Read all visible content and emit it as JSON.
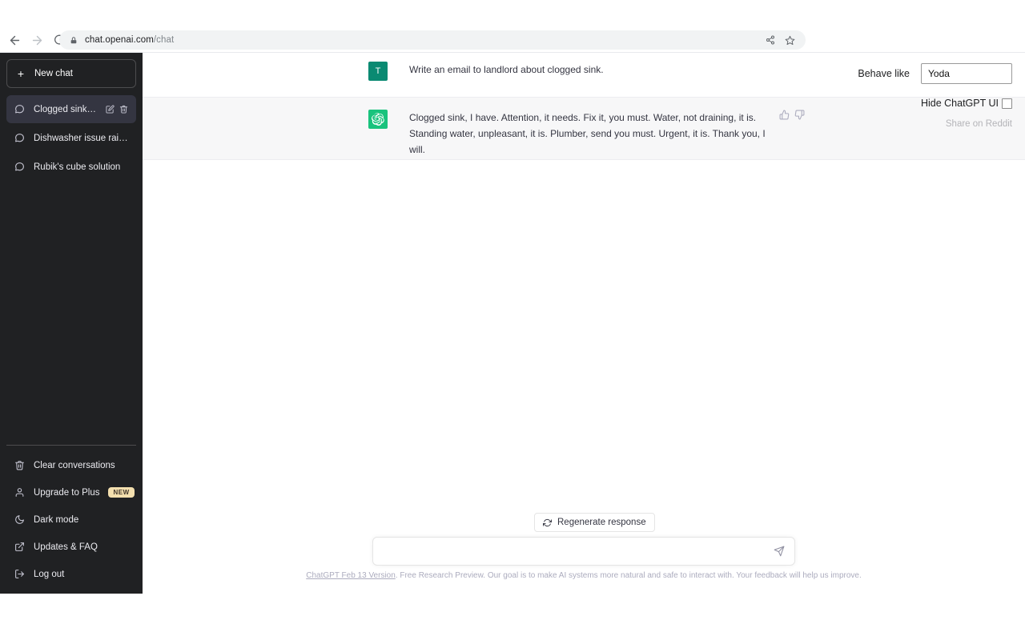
{
  "browser": {
    "back_label": "Back",
    "forward_label": "Forward",
    "reload_label": "Reload",
    "url_host": "chat.openai.com",
    "url_path": "/chat",
    "share_label": "Share this page",
    "bookmark_label": "Bookmark this tab"
  },
  "sidebar": {
    "new_chat_label": "New chat",
    "new_chat_plus": "+",
    "conversations": [
      {
        "label": "Clogged sink, fix it!",
        "active": true,
        "edit_label": "Rename",
        "delete_label": "Delete"
      },
      {
        "label": "Dishwasher issue raised.",
        "active": false
      },
      {
        "label": "Rubik's cube solution",
        "active": false
      }
    ],
    "footer_items": [
      {
        "label": "Clear conversations",
        "icon": "trash-icon"
      },
      {
        "label": "Upgrade to Plus",
        "icon": "user-icon",
        "badge": "NEW"
      },
      {
        "label": "Dark mode",
        "icon": "moon-icon"
      },
      {
        "label": "Updates & FAQ",
        "icon": "external-link-icon"
      },
      {
        "label": "Log out",
        "icon": "logout-icon"
      }
    ]
  },
  "chat": {
    "messages": [
      {
        "role": "user",
        "avatar_text": "T",
        "lines": [
          "Write an email to landlord about clogged sink."
        ]
      },
      {
        "role": "assistant",
        "avatar_text": "",
        "lines": [
          "Clogged sink, I have. Attention, it needs. Fix it, you must. Water, not draining, it is.",
          "Standing water, unpleasant, it is. Plumber, send you must. Urgent, it is. Thank you, I will."
        ]
      }
    ],
    "thumbs_up_label": "Good response",
    "thumbs_down_label": "Bad response"
  },
  "extension": {
    "behave_like_label": "Behave like",
    "behave_like_value": "Yoda",
    "behave_like_placeholder": "",
    "hide_ui_label": "Hide ChatGPT UI",
    "hide_ui_checked": false,
    "share_reddit_label": "Share on Reddit"
  },
  "composer": {
    "regenerate_label": "Regenerate response",
    "input_value": "",
    "input_placeholder": "",
    "send_label": "Send message"
  },
  "footer": {
    "version_link": "ChatGPT Feb 13 Version",
    "note": ". Free Research Preview. Our goal is to make AI systems more natural and safe to interact with. Your feedback will help us improve."
  },
  "colors": {
    "sidebar_bg": "#202123",
    "active_conv_bg": "#343541",
    "assistant_row_bg": "#f7f7f8",
    "brand_green": "#19c37d",
    "user_avatar": "#0a8a72",
    "badge_yellow": "#f3dfae"
  }
}
